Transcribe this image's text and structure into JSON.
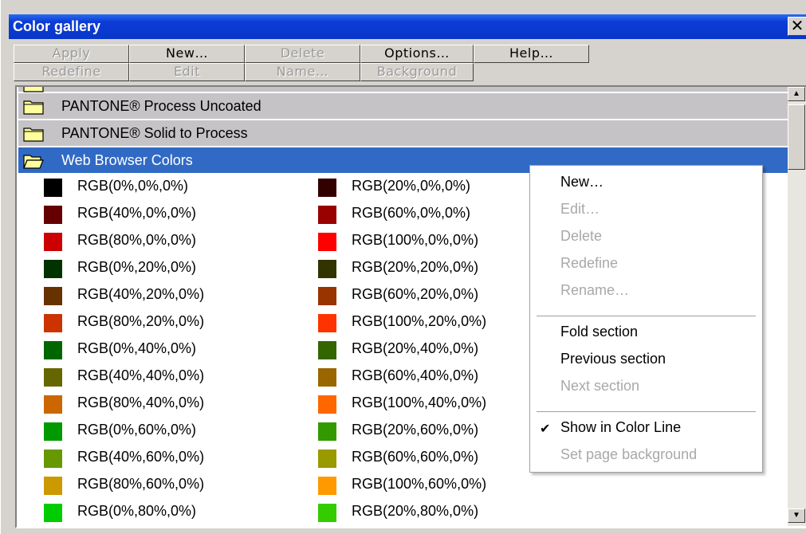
{
  "window": {
    "title": "Color gallery",
    "close_glyph": "✕"
  },
  "toolbar": {
    "row1": [
      {
        "label": "Apply",
        "enabled": false
      },
      {
        "label": "New…",
        "enabled": true
      },
      {
        "label": "Delete",
        "enabled": false
      },
      {
        "label": "Options…",
        "enabled": true
      },
      {
        "label": "Help…",
        "enabled": true
      }
    ],
    "row2": [
      {
        "label": "Redefine",
        "enabled": false
      },
      {
        "label": "Edit",
        "enabled": false
      },
      {
        "label": "Name…",
        "enabled": false
      },
      {
        "label": "Background",
        "enabled": false
      }
    ]
  },
  "sections": [
    {
      "label": "PANTONE® Process Uncoated",
      "selected": false,
      "open": false
    },
    {
      "label": "PANTONE® Solid to Process",
      "selected": false,
      "open": false
    },
    {
      "label": "Web Browser Colors",
      "selected": true,
      "open": true
    }
  ],
  "colors": [
    {
      "label": "RGB(0%,0%,0%)",
      "hex": "#000000"
    },
    {
      "label": "RGB(20%,0%,0%)",
      "hex": "#330000"
    },
    {
      "label": "RGB(40%,0%,0%)",
      "hex": "#660000"
    },
    {
      "label": "RGB(60%,0%,0%)",
      "hex": "#990000"
    },
    {
      "label": "RGB(80%,0%,0%)",
      "hex": "#cc0000"
    },
    {
      "label": "RGB(100%,0%,0%)",
      "hex": "#ff0000"
    },
    {
      "label": "RGB(0%,20%,0%)",
      "hex": "#003300"
    },
    {
      "label": "RGB(20%,20%,0%)",
      "hex": "#333300"
    },
    {
      "label": "RGB(40%,20%,0%)",
      "hex": "#663300"
    },
    {
      "label": "RGB(60%,20%,0%)",
      "hex": "#993300"
    },
    {
      "label": "RGB(80%,20%,0%)",
      "hex": "#cc3300"
    },
    {
      "label": "RGB(100%,20%,0%)",
      "hex": "#ff3300"
    },
    {
      "label": "RGB(0%,40%,0%)",
      "hex": "#006600"
    },
    {
      "label": "RGB(20%,40%,0%)",
      "hex": "#336600"
    },
    {
      "label": "RGB(40%,40%,0%)",
      "hex": "#666600"
    },
    {
      "label": "RGB(60%,40%,0%)",
      "hex": "#996600"
    },
    {
      "label": "RGB(80%,40%,0%)",
      "hex": "#cc6600"
    },
    {
      "label": "RGB(100%,40%,0%)",
      "hex": "#ff6600"
    },
    {
      "label": "RGB(0%,60%,0%)",
      "hex": "#009900"
    },
    {
      "label": "RGB(20%,60%,0%)",
      "hex": "#339900"
    },
    {
      "label": "RGB(40%,60%,0%)",
      "hex": "#669900"
    },
    {
      "label": "RGB(60%,60%,0%)",
      "hex": "#999900"
    },
    {
      "label": "RGB(80%,60%,0%)",
      "hex": "#cc9900"
    },
    {
      "label": "RGB(100%,60%,0%)",
      "hex": "#ff9900"
    },
    {
      "label": "RGB(0%,80%,0%)",
      "hex": "#00cc00"
    },
    {
      "label": "RGB(20%,80%,0%)",
      "hex": "#33cc00"
    }
  ],
  "context_menu": {
    "items": [
      {
        "label": "New…",
        "enabled": true,
        "checked": false
      },
      {
        "label": "Edit…",
        "enabled": false,
        "checked": false
      },
      {
        "label": "Delete",
        "enabled": false,
        "checked": false
      },
      {
        "label": "Redefine",
        "enabled": false,
        "checked": false
      },
      {
        "label": "Rename…",
        "enabled": false,
        "checked": false
      },
      {
        "separator": true
      },
      {
        "label": "Fold section",
        "enabled": true,
        "checked": false
      },
      {
        "label": "Previous section",
        "enabled": true,
        "checked": false
      },
      {
        "label": "Next section",
        "enabled": false,
        "checked": false
      },
      {
        "separator": true
      },
      {
        "label": "Show in Color Line",
        "enabled": true,
        "checked": true
      },
      {
        "label": "Set page background",
        "enabled": false,
        "checked": false
      }
    ],
    "check_glyph": "✔"
  },
  "scrollbar": {
    "up_glyph": "▲",
    "down_glyph": "▼"
  },
  "colors_theme": {
    "title_bar": "#0b3cd6",
    "selection": "#316ac5",
    "section_bg": "#c6c3c6",
    "folder_fill": "#fffe9c"
  }
}
